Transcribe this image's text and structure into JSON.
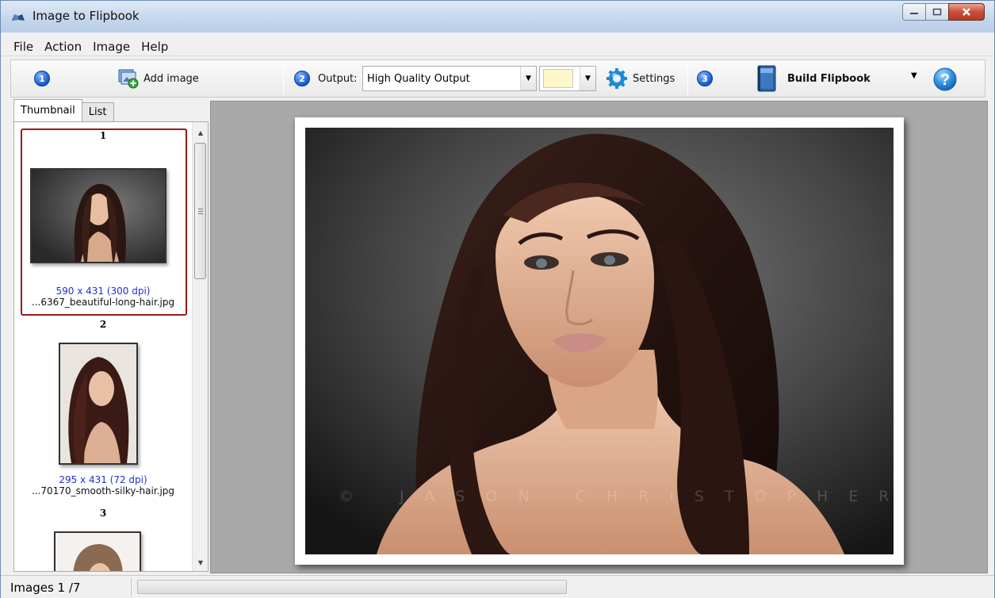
{
  "window": {
    "title": "Image to Flipbook"
  },
  "menu": {
    "items": [
      "File",
      "Action",
      "Image",
      "Help"
    ]
  },
  "toolbar": {
    "step1": "1",
    "add_image": "Add image",
    "step2": "2",
    "output_label": "Output:",
    "output_value": "High Quality Output",
    "color_value": "#fdf7c9",
    "settings": "Settings",
    "step3": "3",
    "build": "Build Flipbook"
  },
  "tabs": {
    "thumbnail": "Thumbnail",
    "list": "List"
  },
  "thumbnails": [
    {
      "number": "1",
      "dimensions": "590 x 431 (300 dpi)",
      "filename": "...6367_beautiful-long-hair.jpg",
      "selected": true
    },
    {
      "number": "2",
      "dimensions": "295 x 431 (72 dpi)",
      "filename": "...70170_smooth-silky-hair.jpg",
      "selected": false
    },
    {
      "number": "3",
      "dimensions": "",
      "filename": "",
      "selected": false
    }
  ],
  "preview": {
    "watermark": "© JASON CHRISTOPHER"
  },
  "status": {
    "text": "Images 1 /7"
  },
  "icons": {
    "app": "book-icon",
    "add_image": "add-image-icon",
    "settings": "gear-icon",
    "build": "book-icon",
    "help": "help-icon"
  }
}
